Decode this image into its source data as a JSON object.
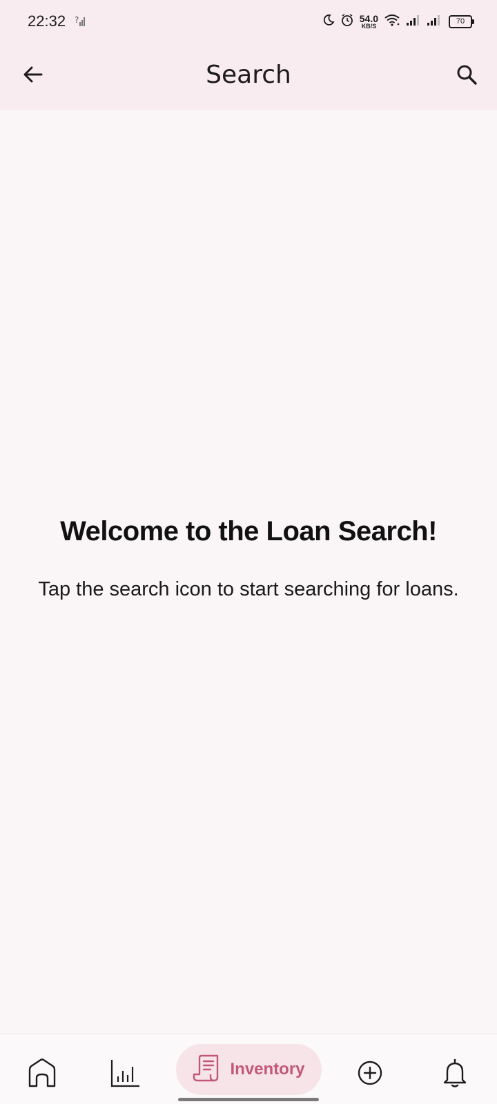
{
  "status_bar": {
    "time": "22:32",
    "net_speed_value": "54.0",
    "net_speed_unit": "KB/S",
    "battery_level": "70",
    "icons": [
      "signal-unknown-icon",
      "moon-icon",
      "alarm-icon",
      "wifi-icon",
      "cell-signal-icon",
      "cell-signal-icon",
      "battery-icon"
    ]
  },
  "app_bar": {
    "title": "Search",
    "back_icon": "arrow-left-icon",
    "search_icon": "search-icon"
  },
  "content": {
    "welcome_title": "Welcome to the Loan Search!",
    "welcome_subtitle": "Tap the search icon to start searching for loans."
  },
  "bottom_nav": {
    "items": [
      {
        "icon": "home-icon",
        "label": ""
      },
      {
        "icon": "bar-chart-icon",
        "label": ""
      },
      {
        "icon": "receipt-icon",
        "label": "Inventory",
        "active": true
      },
      {
        "icon": "add-circle-icon",
        "label": ""
      },
      {
        "icon": "bell-icon",
        "label": ""
      }
    ],
    "active_label": "Inventory"
  },
  "colors": {
    "header_bg": "#f8ecf0",
    "page_bg": "#faf6f7",
    "accent": "#c2577a",
    "active_pill": "#f6e4e9"
  }
}
